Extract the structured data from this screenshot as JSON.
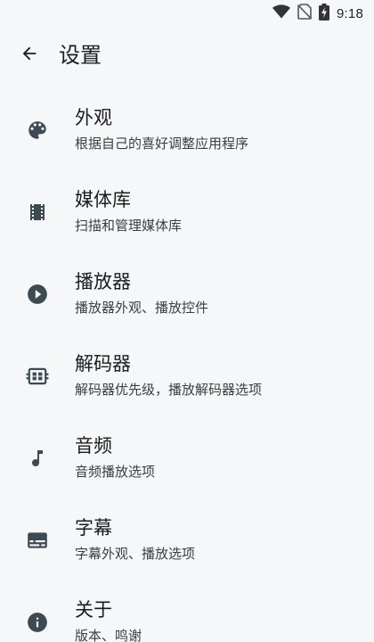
{
  "status_bar": {
    "time": "9:18",
    "icons": [
      "wifi-icon",
      "no-sim-icon",
      "battery-charging-icon"
    ]
  },
  "app_bar": {
    "back_icon": "arrow-back-icon",
    "title": "设置"
  },
  "settings": {
    "items": [
      {
        "icon": "palette-icon",
        "title": "外观",
        "subtitle": "根据自己的喜好调整应用程序"
      },
      {
        "icon": "movie-film-icon",
        "title": "媒体库",
        "subtitle": "扫描和管理媒体库"
      },
      {
        "icon": "play-circle-icon",
        "title": "播放器",
        "subtitle": "播放器外观、播放控件"
      },
      {
        "icon": "decoder-chip-icon",
        "title": "解码器",
        "subtitle": "解码器优先级，播放解码器选项"
      },
      {
        "icon": "music-note-icon",
        "title": "音频",
        "subtitle": "音频播放选项"
      },
      {
        "icon": "subtitles-icon",
        "title": "字幕",
        "subtitle": "字幕外观、播放选项"
      },
      {
        "icon": "info-icon",
        "title": "关于",
        "subtitle": "版本、鸣谢"
      }
    ]
  },
  "colors": {
    "background": "#f6f7f8",
    "icon": "#3e4a52",
    "text_primary": "#1c1c1e",
    "text_secondary": "#3b3d40"
  }
}
